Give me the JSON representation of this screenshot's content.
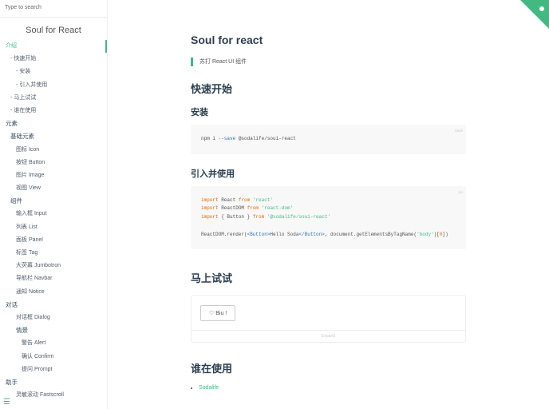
{
  "sidebar": {
    "search_placeholder": "Type to search",
    "brand": "Soul for React",
    "items": [
      {
        "label": "介绍",
        "level": 0,
        "active": true
      },
      {
        "label": "- 快速开始",
        "level": 1
      },
      {
        "label": "- 安装",
        "level": 2
      },
      {
        "label": "- 引入并使用",
        "level": 2
      },
      {
        "label": "- 马上试试",
        "level": 1
      },
      {
        "label": "- 谁在使用",
        "level": 1
      },
      {
        "label": "元素",
        "level": 0,
        "header": true
      },
      {
        "label": "基础元素",
        "level": 1,
        "header": true
      },
      {
        "label": "图标 Icon",
        "level": 2
      },
      {
        "label": "按钮 Button",
        "level": 2
      },
      {
        "label": "图片 Image",
        "level": 2
      },
      {
        "label": "视图 View",
        "level": 2
      },
      {
        "label": "组件",
        "level": 1,
        "header": true
      },
      {
        "label": "输入框 Input",
        "level": 2
      },
      {
        "label": "列表 List",
        "level": 2
      },
      {
        "label": "面板 Panel",
        "level": 2
      },
      {
        "label": "标签 Tag",
        "level": 2
      },
      {
        "label": "大荧幕 Jumbotron",
        "level": 2
      },
      {
        "label": "导航栏 Navbar",
        "level": 2
      },
      {
        "label": "通知 Notice",
        "level": 2
      },
      {
        "label": "对话",
        "level": 0,
        "header": true
      },
      {
        "label": "对话框 Dialog",
        "level": 2
      },
      {
        "label": "情景",
        "level": 2,
        "header": true
      },
      {
        "label": "警告 Alert",
        "level": 3
      },
      {
        "label": "确认 Confirm",
        "level": 3
      },
      {
        "label": "提问 Prompt",
        "level": 3
      },
      {
        "label": "助手",
        "level": 0,
        "header": true
      },
      {
        "label": "灵敏滚动 Fastscroll",
        "level": 2
      }
    ],
    "menu_icon": "☰"
  },
  "main": {
    "title": "Soul for react",
    "subtitle": "苏打 React UI 组件",
    "h_quickstart": "快速开始",
    "h_install": "安装",
    "install_lang": "bash",
    "install_code": {
      "cmd": "npm i ",
      "flag": "--save",
      "pkg": " @sodalife/soui-react"
    },
    "h_import": "引入并使用",
    "import_lang": "jsx",
    "import_code": {
      "import": "import",
      "from": "from",
      "l1": " React ",
      "s1": "'react'",
      "l2": " ReactDOM ",
      "s2": "'react-dom'",
      "l3": " { Button } ",
      "s3": "'@sodalife/soui-react'",
      "r1": "ReactDOM.render(",
      "t1": "<Button>",
      "r2": "Hello Soda",
      "t2": "</Button>",
      "r3": ", document.getElementsByTagName(",
      "s4": "'body'",
      "r4": ")[",
      "n": "0",
      "r5": "])"
    },
    "h_try": "马上试试",
    "try_button": "♡ Biu !",
    "expand": "Expand",
    "h_users": "谁在使用",
    "users": [
      "Sodalife"
    ]
  },
  "colors": {
    "accent": "#42b983"
  }
}
